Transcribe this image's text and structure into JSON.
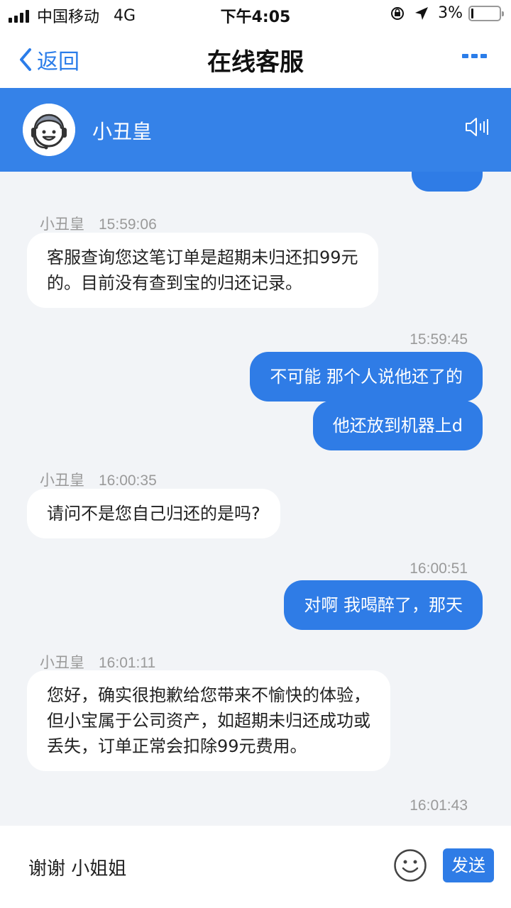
{
  "status_bar": {
    "carrier": "中国移动",
    "network": "4G",
    "time": "下午4:05",
    "battery_percent": "3%",
    "battery_level": 0.03
  },
  "navbar": {
    "back_label": "返回",
    "title": "在线客服"
  },
  "agent": {
    "name": "小丑皇"
  },
  "messages": [
    {
      "from": "agent",
      "sender": "小丑皇",
      "time": "15:59:06",
      "lines": [
        "客服查询您这笔订单是超期未归还扣99元",
        "的。目前没有查到宝的归还记录。"
      ]
    },
    {
      "from": "user",
      "time": "15:59:45",
      "lines": [
        "不可能 那个人说他还了的"
      ]
    },
    {
      "from": "user",
      "time": "",
      "lines": [
        "他还放到机器上d"
      ]
    },
    {
      "from": "agent",
      "sender": "小丑皇",
      "time": "16:00:35",
      "lines": [
        "请问不是您自己归还的是吗?"
      ]
    },
    {
      "from": "user",
      "time": "16:00:51",
      "lines": [
        "对啊 我喝醉了，那天"
      ]
    },
    {
      "from": "agent",
      "sender": "小丑皇",
      "time": "16:01:11",
      "lines": [
        "您好，确实很抱歉给您带来不愉快的体验，",
        "但小宝属于公司资产，如超期未归还成功或",
        "丢失，订单正常会扣除99元费用。"
      ]
    },
    {
      "from": "user",
      "time": "16:01:43",
      "lines": []
    }
  ],
  "input": {
    "value": "谢谢 小姐姐",
    "send_label": "发送"
  },
  "colors": {
    "accent": "#2f7ce6",
    "header": "#3582e8",
    "chat_bg": "#f2f4f7"
  },
  "icons": [
    "signal-icon",
    "lock-rotation-icon",
    "location-arrow-icon",
    "battery-icon",
    "back-chevron-icon",
    "more-icon",
    "agent-avatar",
    "speaker-icon",
    "emoji-icon"
  ]
}
